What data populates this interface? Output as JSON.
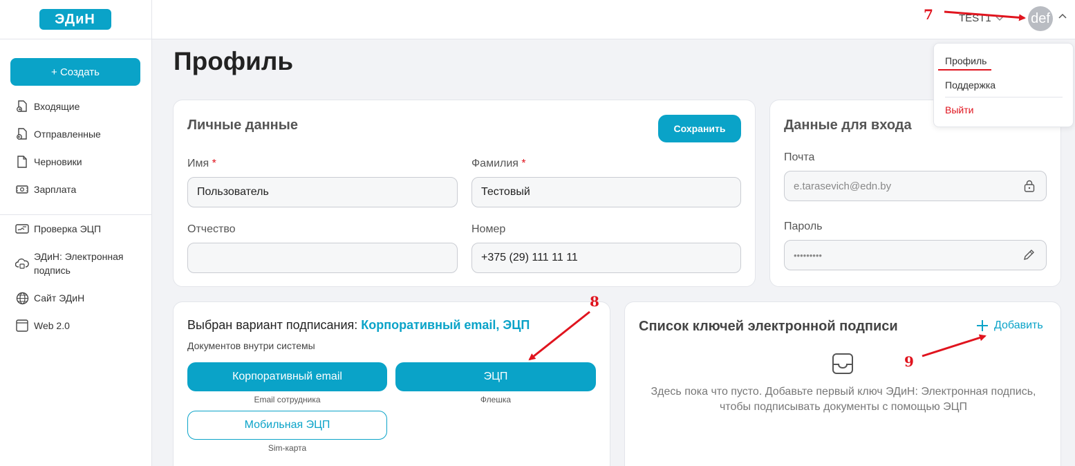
{
  "logo": {
    "text": "ЭДиН"
  },
  "sidebar": {
    "create_label": "+ Создать",
    "items": [
      {
        "label": "Входящие",
        "icon": "inbox-icon"
      },
      {
        "label": "Отправленные",
        "icon": "outbox-icon"
      },
      {
        "label": "Черновики",
        "icon": "draft-icon"
      },
      {
        "label": "Зарплата",
        "icon": "salary-icon"
      }
    ],
    "items2": [
      {
        "label": "Проверка ЭЦП",
        "icon": "signature-check-icon"
      },
      {
        "label": "ЭДиН: Электронная подпись",
        "icon": "cloud-sign-icon"
      },
      {
        "label": "Сайт ЭДиН",
        "icon": "globe-icon"
      },
      {
        "label": "Web 2.0",
        "icon": "window-icon"
      }
    ]
  },
  "header": {
    "org": "TEST1",
    "avatar_text": "def"
  },
  "menu": {
    "items": [
      "Профиль",
      "Поддержка",
      "Выйти"
    ],
    "danger_color": "#e0141e"
  },
  "page": {
    "title": "Профиль"
  },
  "personal": {
    "title": "Личные данные",
    "save_label": "Сохранить",
    "first_name_label": "Имя",
    "first_name_value": "Пользователь",
    "last_name_label": "Фамилия",
    "last_name_value": "Тестовый",
    "middle_name_label": "Отчество",
    "middle_name_value": "",
    "phone_label": "Номер",
    "phone_value": "+375 (29) 111 11 11",
    "required_mark": "*"
  },
  "login": {
    "title": "Данные для входа",
    "email_label": "Почта",
    "email_value": "e.tarasevich@edn.by",
    "password_label": "Пароль",
    "password_value": "•••••••••"
  },
  "signing": {
    "title_prefix": "Выбран вариант подписания: ",
    "title_value": "Корпоративный email, ЭЦП",
    "subtitle": "Документов внутри системы",
    "options": [
      {
        "label": "Корпоративный email",
        "caption": "Email сотрудника",
        "selected": true
      },
      {
        "label": "ЭЦП",
        "caption": "Флешка",
        "selected": true
      },
      {
        "label": "Мобильная ЭЦП",
        "caption": "Sim-карта",
        "selected": false
      }
    ]
  },
  "keys": {
    "title": "Список ключей электронной подписи",
    "add_label": "Добавить",
    "empty_line1": "Здесь пока что пусто. Добавьте первый ключ ЭДиН: Электронная подпись,",
    "empty_line2": "чтобы подписывать документы с помощью ЭЦП"
  },
  "annotations": {
    "a7": "7",
    "a8": "8",
    "a9": "9"
  },
  "colors": {
    "accent": "#0aa3c8",
    "annotation": "#e0141e"
  }
}
